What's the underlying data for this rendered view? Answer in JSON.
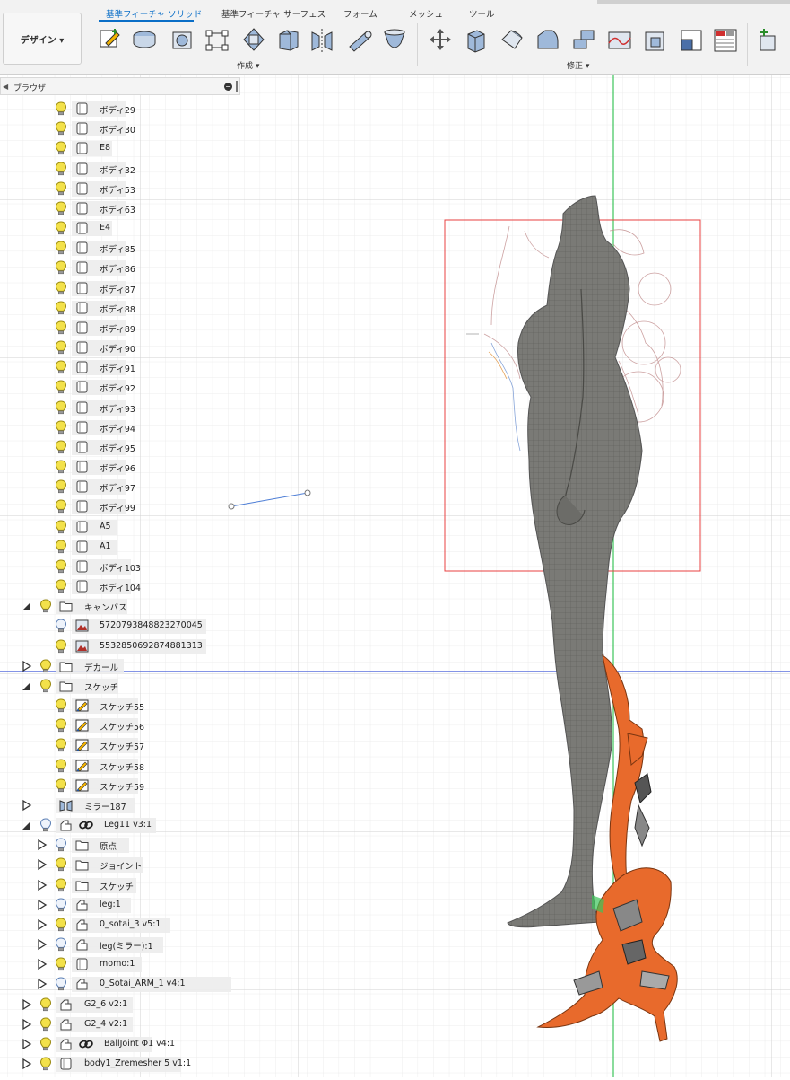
{
  "toolbar": {
    "design_label": "デザイン ▾",
    "tabs": [
      {
        "label": "基準フィーチャ ソリッド",
        "active": true
      },
      {
        "label": "基準フィーチャ サーフェス",
        "active": false
      },
      {
        "label": "フォーム",
        "active": false
      },
      {
        "label": "メッシュ",
        "active": false
      },
      {
        "label": "ツール",
        "active": false
      }
    ],
    "create_label": "作成 ▾",
    "modify_label": "修正 ▾",
    "accent_color": "#0a6ec7"
  },
  "browser": {
    "title": "ブラウザ",
    "items": [
      {
        "label": "ボディ29",
        "type": "body",
        "bulb": "on"
      },
      {
        "label": "ボディ30",
        "type": "body",
        "bulb": "on"
      },
      {
        "label": "E8",
        "type": "body",
        "bulb": "on"
      },
      {
        "label": "ボディ32",
        "type": "body",
        "bulb": "on"
      },
      {
        "label": "ボディ53",
        "type": "body",
        "bulb": "on"
      },
      {
        "label": "ボディ63",
        "type": "body",
        "bulb": "on"
      },
      {
        "label": "E4",
        "type": "body",
        "bulb": "on"
      },
      {
        "label": "ボディ85",
        "type": "body",
        "bulb": "on"
      },
      {
        "label": "ボディ86",
        "type": "body",
        "bulb": "on"
      },
      {
        "label": "ボディ87",
        "type": "body",
        "bulb": "on"
      },
      {
        "label": "ボディ88",
        "type": "body",
        "bulb": "on"
      },
      {
        "label": "ボディ89",
        "type": "body",
        "bulb": "on"
      },
      {
        "label": "ボディ90",
        "type": "body",
        "bulb": "on"
      },
      {
        "label": "ボディ91",
        "type": "body",
        "bulb": "on"
      },
      {
        "label": "ボディ92",
        "type": "body",
        "bulb": "on"
      },
      {
        "label": "ボディ93",
        "type": "body",
        "bulb": "on"
      },
      {
        "label": "ボディ94",
        "type": "body",
        "bulb": "on"
      },
      {
        "label": "ボディ95",
        "type": "body",
        "bulb": "on"
      },
      {
        "label": "ボディ96",
        "type": "body",
        "bulb": "on"
      },
      {
        "label": "ボディ97",
        "type": "body",
        "bulb": "on"
      },
      {
        "label": "ボディ99",
        "type": "body",
        "bulb": "on"
      },
      {
        "label": "A5",
        "type": "body",
        "bulb": "on"
      },
      {
        "label": "A1",
        "type": "body",
        "bulb": "on"
      },
      {
        "label": "ボディ103",
        "type": "body",
        "bulb": "on"
      },
      {
        "label": "ボディ104",
        "type": "body",
        "bulb": "on"
      },
      {
        "label": "キャンバス",
        "type": "folder",
        "bulb": "on",
        "expand": "open"
      },
      {
        "label": "5720793848823270045",
        "type": "canvas",
        "bulb": "off"
      },
      {
        "label": "5532850692874881313",
        "type": "canvas",
        "bulb": "on"
      },
      {
        "label": "デカール",
        "type": "folder",
        "bulb": "on",
        "expand": "closed"
      },
      {
        "label": "スケッチ",
        "type": "folder",
        "bulb": "on",
        "expand": "open"
      },
      {
        "label": "スケッチ55",
        "type": "sketch",
        "bulb": "on"
      },
      {
        "label": "スケッチ56",
        "type": "sketch",
        "bulb": "on"
      },
      {
        "label": "スケッチ57",
        "type": "sketch",
        "bulb": "on"
      },
      {
        "label": "スケッチ58",
        "type": "sketch",
        "bulb": "on"
      },
      {
        "label": "スケッチ59",
        "type": "sketch",
        "bulb": "on"
      },
      {
        "label": "ミラー187",
        "type": "mirror",
        "bulb": "none",
        "expand": "closed"
      },
      {
        "label": "Leg11 v3:1",
        "type": "component",
        "bulb": "off",
        "expand": "open",
        "link": true
      },
      {
        "label": "原点",
        "type": "folder",
        "bulb": "off",
        "expand": "closed"
      },
      {
        "label": "ジョイント",
        "type": "folder",
        "bulb": "on",
        "expand": "closed"
      },
      {
        "label": "スケッチ",
        "type": "folder",
        "bulb": "on",
        "expand": "closed"
      },
      {
        "label": "leg:1",
        "type": "component",
        "bulb": "off",
        "expand": "closed"
      },
      {
        "label": "0_sotai_3 v5:1",
        "type": "component",
        "bulb": "on",
        "expand": "closed"
      },
      {
        "label": "leg(ミラー):1",
        "type": "component",
        "bulb": "off",
        "expand": "closed"
      },
      {
        "label": "momo:1",
        "type": "body",
        "bulb": "on",
        "expand": "closed"
      },
      {
        "label": "0_Sotai_ARM_1 v4:1",
        "type": "component",
        "bulb": "off",
        "expand": "closed"
      },
      {
        "label": "G2_6 v2:1",
        "type": "component",
        "bulb": "on",
        "expand": "closed"
      },
      {
        "label": "G2_4 v2:1",
        "type": "component",
        "bulb": "on",
        "expand": "closed"
      },
      {
        "label": "BallJoint Φ1 v4:1",
        "type": "component",
        "bulb": "on",
        "expand": "closed",
        "link": true
      },
      {
        "label": "body1_Zremesher 5 v1:1",
        "type": "body",
        "bulb": "on",
        "expand": "closed"
      }
    ]
  },
  "viewport": {
    "model_color": "#7a7a76",
    "armor_color": "#e86a2c",
    "canvas_frame_color": "#e84040",
    "axis_green": "#3cc45a",
    "axis_blue": "#3a55d8"
  }
}
